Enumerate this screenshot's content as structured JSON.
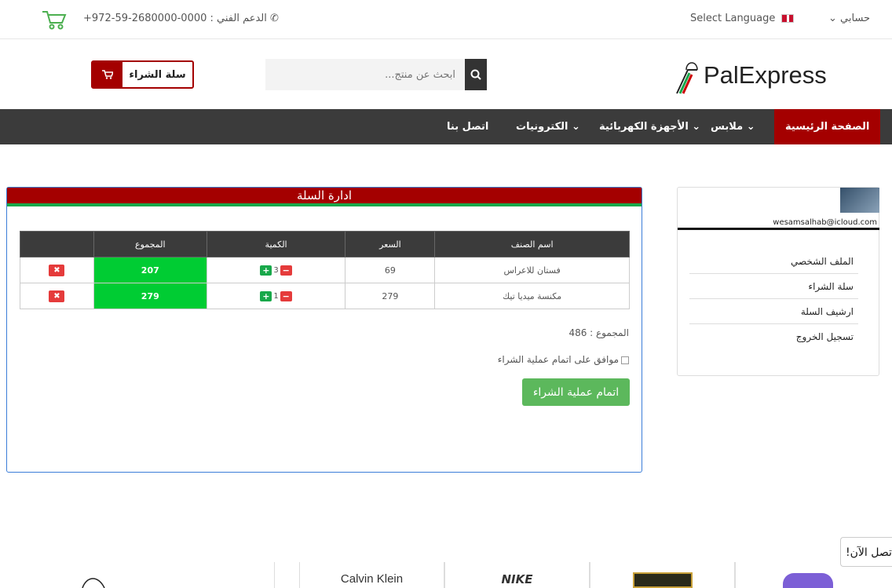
{
  "topbar": {
    "support_text": "الدعم الفني : 0000-2680000-59-972+",
    "language_label": "Select Language",
    "account_label": "حسابي",
    "support_icon": "whatsapp-icon",
    "cart_logo_icon": "shopping-cart-icon"
  },
  "header": {
    "cart_button_label": "سلة الشراء",
    "search_placeholder": "ابحث عن منتج...",
    "logo_text": "PalExpress"
  },
  "nav": {
    "items": [
      {
        "label": "الصفحة الرئيسية",
        "active": true
      },
      {
        "label": "ملابس",
        "active": false
      },
      {
        "label": "الأجهزة الكهربائية",
        "active": false
      },
      {
        "label": "الكترونيات",
        "active": false
      },
      {
        "label": "اتصل بنا",
        "active": false
      }
    ]
  },
  "cart": {
    "title": "ادارة السلة",
    "columns": [
      "اسم الصنف",
      "السعر",
      "الكمية",
      "المجموع",
      ""
    ],
    "rows": [
      {
        "name": "فستان للاعراس",
        "price": "69",
        "qty": "3",
        "sum": "207"
      },
      {
        "name": "مكنسة ميديا تيك",
        "price": "279",
        "qty": "1",
        "sum": "279"
      }
    ],
    "total_text": "المجموع : 486",
    "agree_text": "موافق على اتمام عملية الشراء",
    "checkout_label": "اتمام عملية الشراء",
    "colors": {
      "header_bar": "#a40000",
      "sum_cell": "#00cc33",
      "checkout": "#5cb85c"
    }
  },
  "sidebar": {
    "email": "wesamsalhab@icloud.com",
    "links": [
      "الملف الشخصي",
      "سلة الشراء",
      "ارشيف السلة",
      "تسجيل الخروج"
    ]
  },
  "chat": {
    "label": "اتصل الآن!"
  },
  "brands": [
    "Calvin Klein",
    "NIKE"
  ]
}
